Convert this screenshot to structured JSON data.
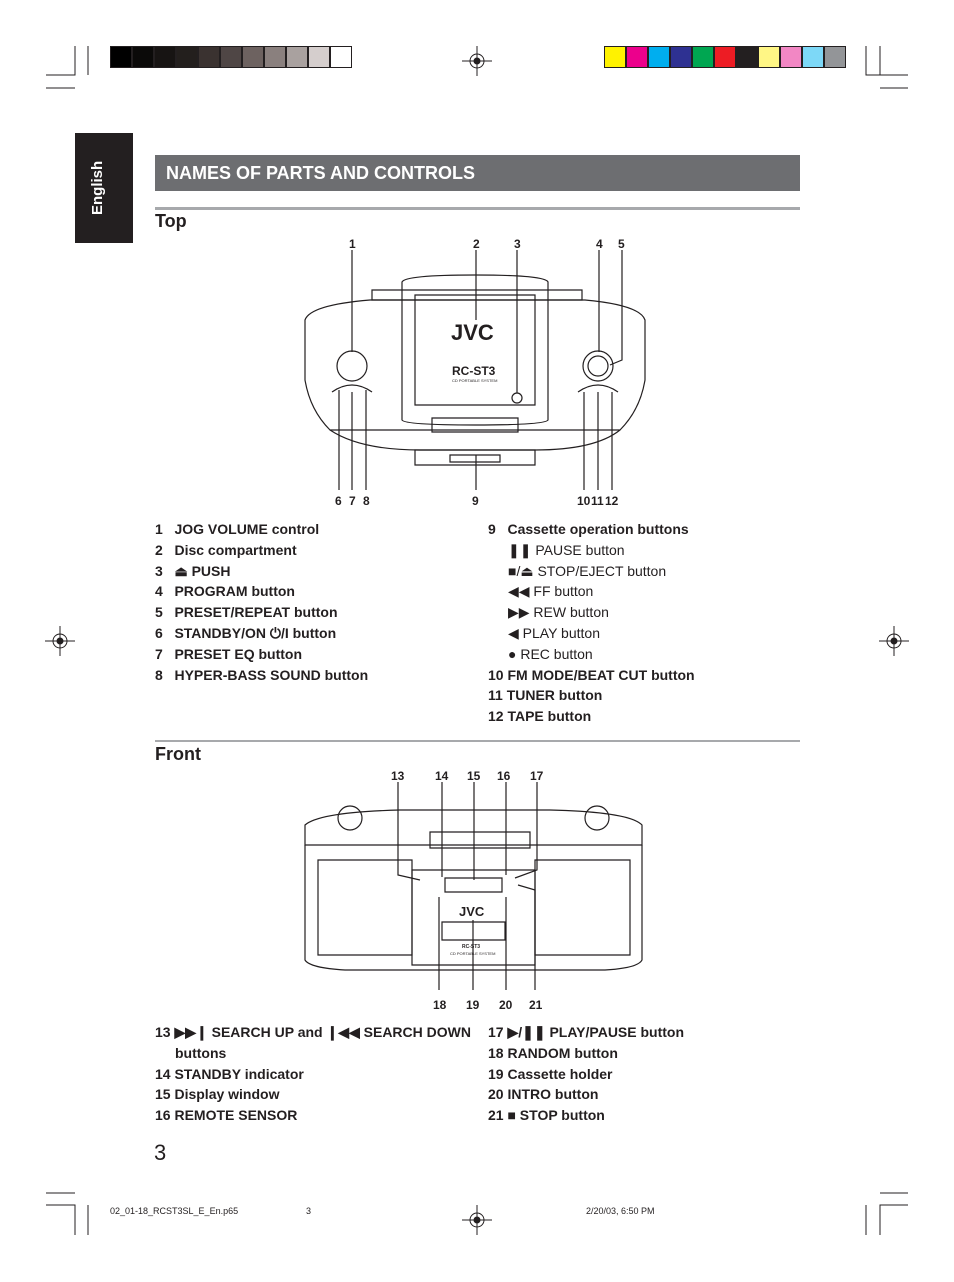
{
  "color_bars": {
    "gray": [
      "#000000",
      "#0b0a09",
      "#171413",
      "#231f1d",
      "#3a3230",
      "#4f4645",
      "#6d6260",
      "#8a807e",
      "#a9a19f",
      "#d5cecd",
      "#ffffff"
    ],
    "color": [
      "#fff200",
      "#ec008c",
      "#00aeef",
      "#2e3192",
      "#00a651",
      "#ed1c24",
      "#231f20",
      "#fff685",
      "#f287c4",
      "#7dd8f7",
      "#939598"
    ]
  },
  "language_tab": "English",
  "heading": "NAMES OF PARTS AND CONTROLS",
  "top": {
    "title": "Top",
    "callouts_top": [
      "1",
      "2",
      "3",
      "4",
      "5"
    ],
    "callouts_bottom": [
      "6",
      "7",
      "8",
      "9",
      "10",
      "11",
      "12"
    ],
    "logo": "JVC",
    "model": "RC-ST3",
    "model_sub": "CD PORTABLE SYSTEM",
    "left_list": [
      "1   JOG VOLUME control",
      "2   Disc compartment",
      "3   ⏏ PUSH",
      "4   PROGRAM button",
      "5   PRESET/REPEAT button",
      "6   STANDBY/ON ⏻/I button",
      "7   PRESET EQ button",
      "8   HYPER-BASS SOUND button"
    ],
    "right_title": "9   Cassette operation buttons",
    "right_sub": [
      "❚❚ PAUSE button",
      "■/⏏ STOP/EJECT button",
      "◀◀ FF button",
      "▶▶ REW button",
      "◀ PLAY button",
      "● REC button"
    ],
    "right_list": [
      "10 FM MODE/BEAT CUT button",
      "11 TUNER button",
      "12 TAPE button"
    ]
  },
  "front": {
    "title": "Front",
    "callouts_top": [
      "13",
      "14",
      "15",
      "16",
      "17"
    ],
    "callouts_bottom": [
      "18",
      "19",
      "20",
      "21"
    ],
    "logo": "JVC",
    "model": "RC-ST3",
    "model_sub": "CD PORTABLE SYSTEM",
    "left_list": [
      "13 ▶▶❙ SEARCH UP and ❙◀◀ SEARCH DOWN",
      "buttons",
      "14 STANDBY indicator",
      "15 Display window",
      "16 REMOTE SENSOR"
    ],
    "right_list": [
      "17 ▶/❚❚ PLAY/PAUSE button",
      "18 RANDOM button",
      "19 Cassette holder",
      "20 INTRO button",
      "21 ■ STOP button"
    ]
  },
  "page_number": "3",
  "footer": {
    "file": "02_01-18_RCST3SL_E_En.p65",
    "page": "3",
    "date": "2/20/03, 6:50 PM"
  }
}
